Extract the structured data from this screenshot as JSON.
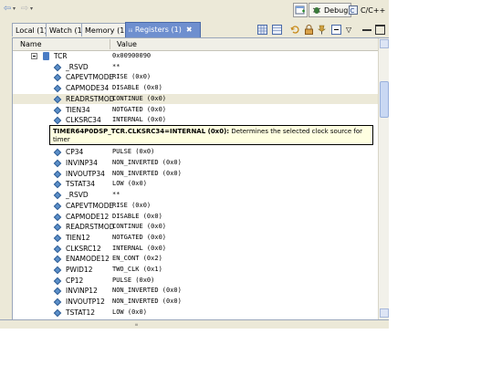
{
  "toolbar": {
    "perspectives": [
      {
        "label": "Debug",
        "icon": "debug-bug-icon",
        "active": true
      },
      {
        "label": "C/C++",
        "icon": "cpp-perspective-icon",
        "active": false
      }
    ]
  },
  "tabs": [
    {
      "label": "Local (1)"
    },
    {
      "label": "Watch (1)"
    },
    {
      "label": "Memory (1)"
    },
    {
      "label": "Registers (1)",
      "active": true,
      "close": "✖"
    }
  ],
  "table": {
    "columns": [
      "Name",
      "Value"
    ],
    "register": {
      "name": "TCR",
      "value": "0x00900090"
    },
    "fields": [
      {
        "name": "_RSVD",
        "value": "**"
      },
      {
        "name": "CAPEVTMODE",
        "value": "RISE (0x0)"
      },
      {
        "name": "CAPMODE34",
        "value": "DISABLE (0x0)"
      },
      {
        "name": "READRSTMOD",
        "value": "CONTINUE (0x0)",
        "selected": true
      },
      {
        "name": "TIEN34",
        "value": "NOTGATED (0x0)"
      },
      {
        "name": "CLKSRC34",
        "value": "INTERNAL (0x0)"
      },
      {
        "name": "",
        "value": ""
      },
      {
        "name": "",
        "value": ""
      },
      {
        "name": "CP34",
        "value": "PULSE (0x0)"
      },
      {
        "name": "INVINP34",
        "value": "NON_INVERTED (0x0)"
      },
      {
        "name": "INVOUTP34",
        "value": "NON_INVERTED (0x0)"
      },
      {
        "name": "TSTAT34",
        "value": "LOW (0x0)"
      },
      {
        "name": "_RSVD",
        "value": "**"
      },
      {
        "name": "CAPEVTMODE",
        "value": "RISE (0x0)"
      },
      {
        "name": "CAPMODE12",
        "value": "DISABLE (0x0)"
      },
      {
        "name": "READRSTMOD",
        "value": "CONTINUE (0x0)"
      },
      {
        "name": "TIEN12",
        "value": "NOTGATED (0x0)"
      },
      {
        "name": "CLKSRC12",
        "value": "INTERNAL (0x0)"
      },
      {
        "name": "ENAMODE12",
        "value": "EN_CONT (0x2)"
      },
      {
        "name": "PWID12",
        "value": "TWO_CLK (0x1)"
      },
      {
        "name": "CP12",
        "value": "PULSE (0x0)"
      },
      {
        "name": "INVINP12",
        "value": "NON_INVERTED (0x0)"
      },
      {
        "name": "INVOUTP12",
        "value": "NON_INVERTED (0x0)"
      },
      {
        "name": "TSTAT12",
        "value": "LOW (0x0)"
      }
    ]
  },
  "tooltip": {
    "title": "TIMER64P0DSP_TCR.CLKSRC34=INTERNAL (0x0):",
    "text": "Determines the selected clock source for timer"
  },
  "colors": {
    "active_tab": "#6e8fcf",
    "field_icon": "#5b8fc9",
    "tooltip_bg": "#ffffe1"
  }
}
